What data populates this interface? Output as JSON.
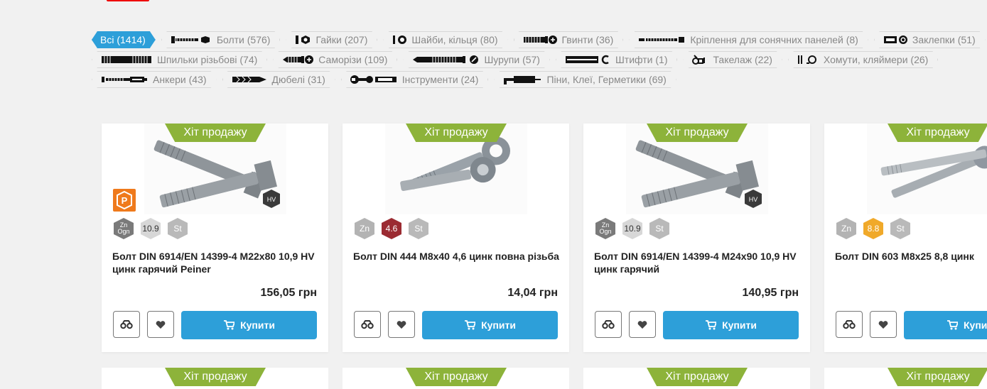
{
  "tags": [
    {
      "label": "Всі (1414)",
      "icon": "none",
      "active": true
    },
    {
      "label": "Болти (576)",
      "icon": "bolt-icon"
    },
    {
      "label": "Гайки (207)",
      "icon": "nut-icon"
    },
    {
      "label": "Шайби, кільця (80)",
      "icon": "washer-icon"
    },
    {
      "label": "Гвинти (36)",
      "icon": "screw-icon"
    },
    {
      "label": "Кріплення для сонячних панелей (8)",
      "icon": "solar-mount-icon"
    },
    {
      "label": "Заклепки (51)",
      "icon": "rivet-icon"
    },
    {
      "label": "Шпильки різьбові (74)",
      "icon": "threaded-rod-icon"
    },
    {
      "label": "Саморізи (109)",
      "icon": "self-tapping-screw-icon"
    },
    {
      "label": "Шурупи (57)",
      "icon": "wood-screw-icon"
    },
    {
      "label": "Штифти (1)",
      "icon": "pin-icon"
    },
    {
      "label": "Такелаж (22)",
      "icon": "rigging-icon"
    },
    {
      "label": "Хомути, кляймери (26)",
      "icon": "clamp-icon"
    },
    {
      "label": "Анкери (43)",
      "icon": "anchor-icon"
    },
    {
      "label": "Дюбелі (31)",
      "icon": "dowel-icon"
    },
    {
      "label": "Інструменти (24)",
      "icon": "tools-icon"
    },
    {
      "label": "Піни, Клеї, Герметики (69)",
      "icon": "foam-gun-icon"
    }
  ],
  "hit_label": "Хіт продажу",
  "buy_label": "Купити",
  "products": [
    {
      "name": "Болт DIN 6914/EN 14399-4 M22x80 10,9 HV цинк гарячий Peiner",
      "price": "156,05 грн",
      "badges": [
        {
          "text": "Zn Ogn",
          "color": "#7a7a7a",
          "small": true
        },
        {
          "text": "10.9",
          "color": "#d7d7d7",
          "dark": true
        },
        {
          "text": "St",
          "color": "#b9b9b9"
        }
      ],
      "hv": "HV",
      "brand": "P"
    },
    {
      "name": "Болт DIN 444 M8x40 4,6 цинк повна різьба",
      "price": "14,04 грн",
      "badges": [
        {
          "text": "Zn",
          "color": "#b3b3b3"
        },
        {
          "text": "4.6",
          "color": "#9b2b32"
        },
        {
          "text": "St",
          "color": "#b9b9b9"
        }
      ]
    },
    {
      "name": "Болт DIN 6914/EN 14399-4 M24x90 10,9 HV цинк гарячий",
      "price": "140,95 грн",
      "badges": [
        {
          "text": "Zn Ogn",
          "color": "#7a7a7a",
          "small": true
        },
        {
          "text": "10.9",
          "color": "#d7d7d7",
          "dark": true
        },
        {
          "text": "St",
          "color": "#b9b9b9"
        }
      ],
      "hv": "HV"
    },
    {
      "name": "Болт DIN 603 M8x25 8,8 цинк",
      "price": "",
      "badges": [
        {
          "text": "Zn",
          "color": "#b3b3b3"
        },
        {
          "text": "8.8",
          "color": "#f0a92a"
        },
        {
          "text": "St",
          "color": "#b9b9b9"
        }
      ]
    }
  ],
  "colors": {
    "accent": "#2d9fd9",
    "hit": "#8db33a",
    "brand": "#ef7a1c"
  }
}
